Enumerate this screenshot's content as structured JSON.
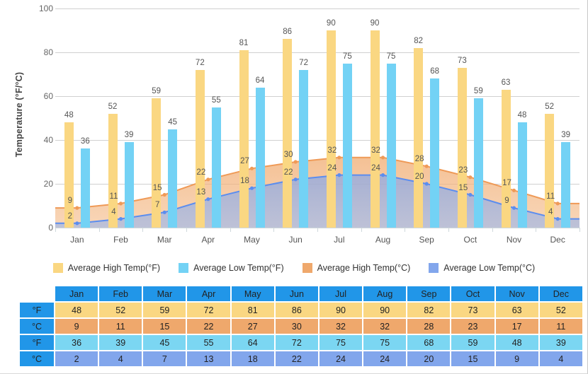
{
  "chart_data": {
    "type": "bar",
    "title": "",
    "xlabel": "",
    "ylabel": "Temperature (°F/°C)",
    "ylim": [
      0,
      100
    ],
    "yticks": [
      0,
      20,
      40,
      60,
      80,
      100
    ],
    "grid": true,
    "legend_position": "bottom",
    "categories": [
      "Jan",
      "Feb",
      "Mar",
      "Apr",
      "May",
      "Jun",
      "Jul",
      "Aug",
      "Sep",
      "Oct",
      "Nov",
      "Dec"
    ],
    "series": [
      {
        "name": "Average High Temp(°F)",
        "type": "bar",
        "color": "#fad782",
        "values": [
          48,
          52,
          59,
          72,
          81,
          86,
          90,
          90,
          82,
          73,
          63,
          52
        ]
      },
      {
        "name": "Average Low Temp(°F)",
        "type": "bar",
        "color": "#73d2f5",
        "values": [
          36,
          39,
          45,
          55,
          64,
          72,
          75,
          75,
          68,
          59,
          48,
          39
        ]
      },
      {
        "name": "Average High Temp(°C)",
        "type": "area",
        "color": "#efa86c",
        "values": [
          9,
          11,
          15,
          22,
          27,
          30,
          32,
          32,
          28,
          23,
          17,
          11
        ]
      },
      {
        "name": "Average Low Temp(°C)",
        "type": "area",
        "color": "#82a6ec",
        "values": [
          2,
          4,
          7,
          13,
          18,
          22,
          24,
          24,
          20,
          15,
          9,
          4
        ]
      }
    ]
  },
  "axis": {
    "y_title": "Temperature (°F/°C)",
    "y_ticks": [
      "100",
      "80",
      "60",
      "40",
      "20",
      "0"
    ],
    "x_ticks": [
      "Jan",
      "Feb",
      "Mar",
      "Apr",
      "May",
      "Jun",
      "Jul",
      "Aug",
      "Sep",
      "Oct",
      "Nov",
      "Dec"
    ]
  },
  "legend": {
    "items": [
      {
        "label": "Average High Temp(°F)",
        "color": "#fad782"
      },
      {
        "label": "Average Low Temp(°F)",
        "color": "#73d2f5"
      },
      {
        "label": "Average High Temp(°C)",
        "color": "#efa86c"
      },
      {
        "label": "Average Low Temp(°C)",
        "color": "#82a6ec"
      }
    ]
  },
  "table": {
    "corner": "",
    "columns": [
      "Jan",
      "Feb",
      "Mar",
      "Apr",
      "May",
      "Jun",
      "Jul",
      "Aug",
      "Sep",
      "Oct",
      "Nov",
      "Dec"
    ],
    "rows": [
      {
        "unit": "°F",
        "cls": "c-hf",
        "values": [
          "48",
          "52",
          "59",
          "72",
          "81",
          "86",
          "90",
          "90",
          "82",
          "73",
          "63",
          "52"
        ]
      },
      {
        "unit": "°C",
        "cls": "c-hc",
        "values": [
          "9",
          "11",
          "15",
          "22",
          "27",
          "30",
          "32",
          "32",
          "28",
          "23",
          "17",
          "11"
        ]
      },
      {
        "unit": "°F",
        "cls": "c-lf",
        "values": [
          "36",
          "39",
          "45",
          "55",
          "64",
          "72",
          "75",
          "75",
          "68",
          "59",
          "48",
          "39"
        ]
      },
      {
        "unit": "°C",
        "cls": "c-lc",
        "values": [
          "2",
          "4",
          "7",
          "13",
          "18",
          "22",
          "24",
          "24",
          "20",
          "15",
          "9",
          "4"
        ]
      }
    ]
  },
  "colors": {
    "high_f": "#fad782",
    "low_f": "#73d2f5",
    "high_c": "#efa86c",
    "low_c": "#82a6ec",
    "header_blue": "#2196e8",
    "gridline": "#d0d0d0"
  }
}
